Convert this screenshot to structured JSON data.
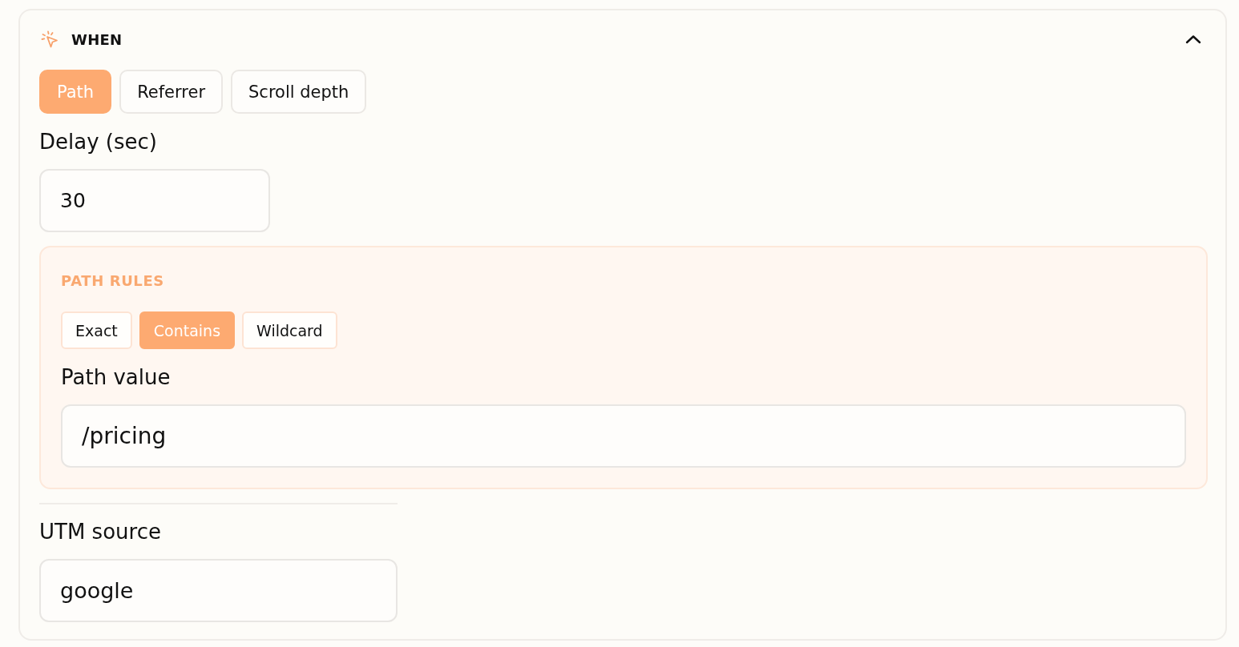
{
  "section": {
    "title": "WHEN",
    "expanded": true
  },
  "trigger_tabs": [
    {
      "label": "Path",
      "selected": true
    },
    {
      "label": "Referrer",
      "selected": false
    },
    {
      "label": "Scroll depth",
      "selected": false
    }
  ],
  "delay": {
    "label": "Delay (sec)",
    "value": "30"
  },
  "path_rules": {
    "title": "PATH RULES",
    "modes": [
      {
        "label": "Exact",
        "selected": false
      },
      {
        "label": "Contains",
        "selected": true
      },
      {
        "label": "Wildcard",
        "selected": false
      }
    ],
    "value_label": "Path value",
    "value": "/pricing"
  },
  "utm_source": {
    "label": "UTM source",
    "value": "google"
  }
}
